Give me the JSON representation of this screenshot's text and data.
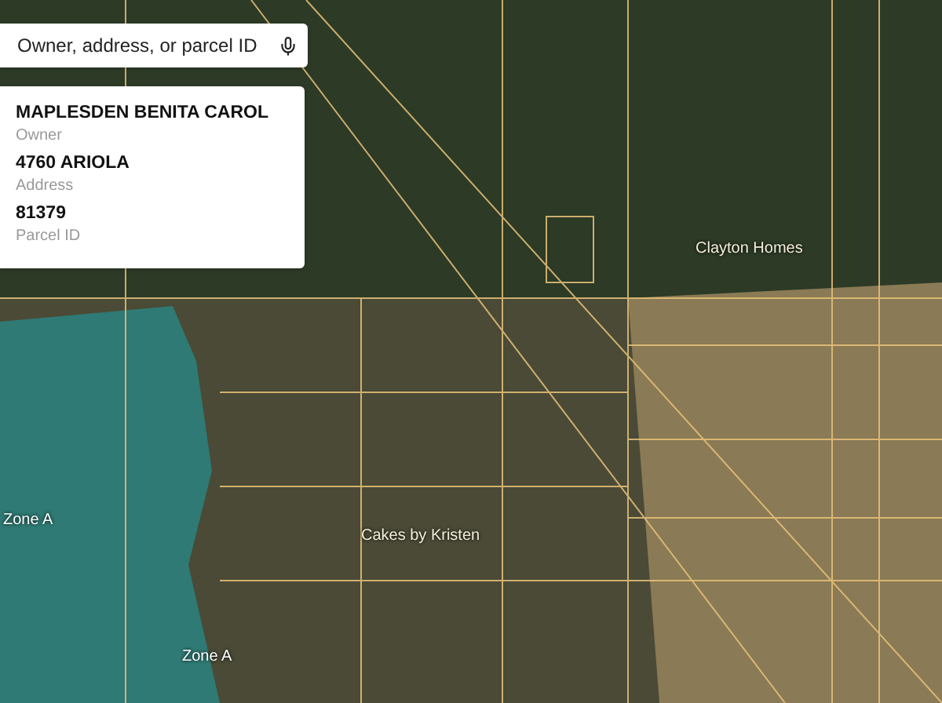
{
  "search": {
    "placeholder": "Owner, address, or parcel ID"
  },
  "parcel_card": {
    "fields": [
      {
        "value": "MAPLESDEN BENITA CAROL",
        "label": "Owner"
      },
      {
        "value": "4760 ARIOLA",
        "label": "Address"
      },
      {
        "value": "81379",
        "label": "Parcel ID"
      }
    ]
  },
  "map_labels": [
    {
      "text": "Clayton Homes",
      "kind": "place"
    },
    {
      "text": "Cakes by Kristen",
      "kind": "place"
    },
    {
      "text": "Zone A",
      "kind": "zone"
    },
    {
      "text": "Zone A",
      "kind": "zone"
    }
  ]
}
